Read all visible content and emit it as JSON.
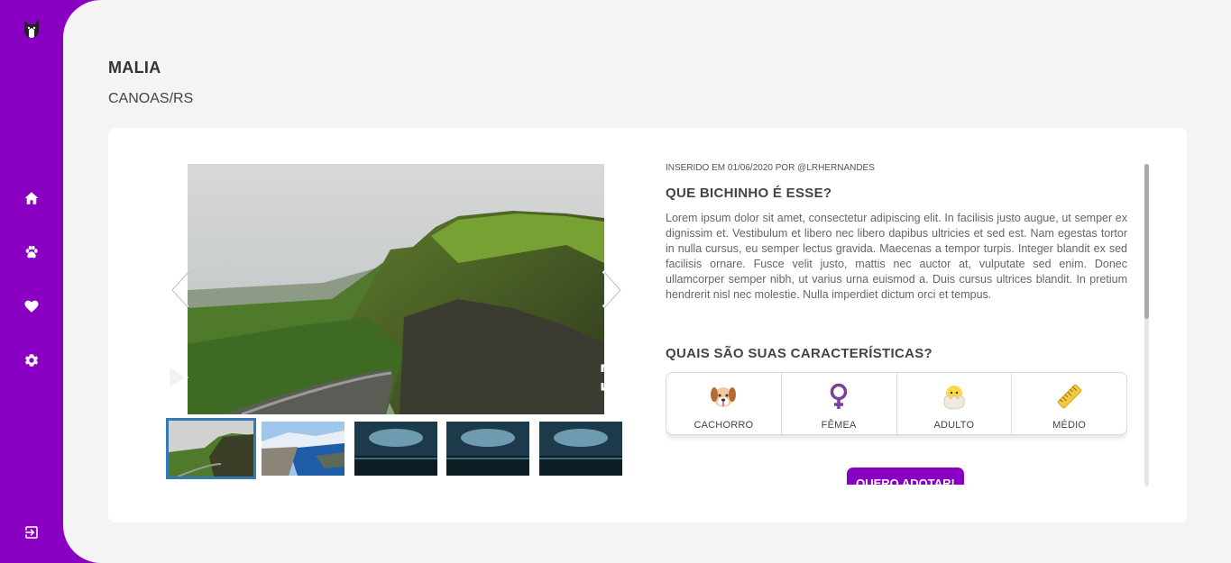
{
  "sidebar": {
    "logo_icon": "cat-logo-icon",
    "items": [
      {
        "icon": "home-icon"
      },
      {
        "icon": "paw-icon"
      },
      {
        "icon": "heart-icon"
      },
      {
        "icon": "gear-icon"
      }
    ],
    "logout_icon": "logout-icon",
    "color": "#8a00c2"
  },
  "pet": {
    "name": "MALIA",
    "location": "CANOAS/RS"
  },
  "gallery": {
    "active_index": 0,
    "thumbnails": [
      "mountain-valley",
      "fjord",
      "stormy-sea",
      "stormy-sea",
      "stormy-sea"
    ]
  },
  "info": {
    "meta": "INSERIDO EM 01/06/2020 POR @LRHERNANDES",
    "question_title": "QUE BICHINHO É ESSE?",
    "description": "Lorem ipsum dolor sit amet, consectetur adipiscing elit. In facilisis justo augue, ut semper ex dignissim et. Vestibulum et libero nec libero dapibus ultricies et sed est. Nam egestas tortor in nulla cursus, eu semper lectus gravida. Maecenas a tempor turpis. Integer blandit ex sed facilisis ornare. Fusce velit justo, mattis nec auctor at, vulputate sed enim. Donec ullamcorper semper nibh, ut varius urna euismod a. Duis cursus ultrices blandit. In pretium hendrerit nisl nec molestie. Nulla imperdiet dictum orci et tempus.",
    "traits_title": "QUAIS SÃO SUAS CARACTERÍSTICAS?",
    "traits": [
      {
        "label": "CACHORRO",
        "icon": "dog-icon"
      },
      {
        "label": "FÊMEA",
        "icon": "female-icon"
      },
      {
        "label": "ADULTO",
        "icon": "chick-icon"
      },
      {
        "label": "MÉDIO",
        "icon": "ruler-icon"
      }
    ],
    "adopt_button": "QUERO ADOTAR!"
  },
  "colors": {
    "accent": "#8a00c2",
    "thumb_active_border": "#337ab7"
  }
}
